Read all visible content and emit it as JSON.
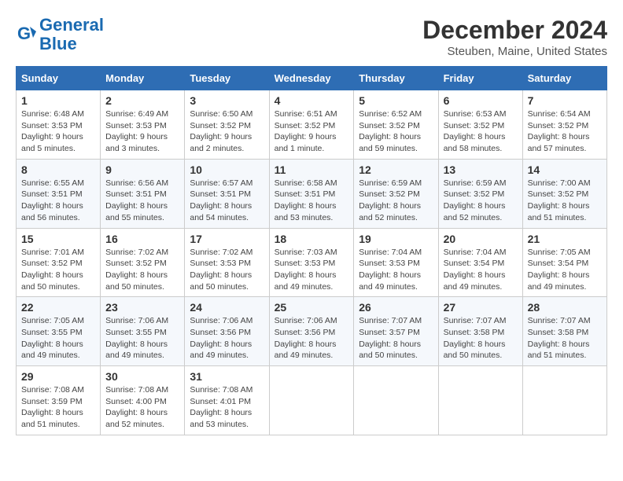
{
  "header": {
    "logo_line1": "General",
    "logo_line2": "Blue",
    "month_title": "December 2024",
    "location": "Steuben, Maine, United States"
  },
  "weekdays": [
    "Sunday",
    "Monday",
    "Tuesday",
    "Wednesday",
    "Thursday",
    "Friday",
    "Saturday"
  ],
  "weeks": [
    [
      {
        "day": "1",
        "info": "Sunrise: 6:48 AM\nSunset: 3:53 PM\nDaylight: 9 hours\nand 5 minutes."
      },
      {
        "day": "2",
        "info": "Sunrise: 6:49 AM\nSunset: 3:53 PM\nDaylight: 9 hours\nand 3 minutes."
      },
      {
        "day": "3",
        "info": "Sunrise: 6:50 AM\nSunset: 3:52 PM\nDaylight: 9 hours\nand 2 minutes."
      },
      {
        "day": "4",
        "info": "Sunrise: 6:51 AM\nSunset: 3:52 PM\nDaylight: 9 hours\nand 1 minute."
      },
      {
        "day": "5",
        "info": "Sunrise: 6:52 AM\nSunset: 3:52 PM\nDaylight: 8 hours\nand 59 minutes."
      },
      {
        "day": "6",
        "info": "Sunrise: 6:53 AM\nSunset: 3:52 PM\nDaylight: 8 hours\nand 58 minutes."
      },
      {
        "day": "7",
        "info": "Sunrise: 6:54 AM\nSunset: 3:52 PM\nDaylight: 8 hours\nand 57 minutes."
      }
    ],
    [
      {
        "day": "8",
        "info": "Sunrise: 6:55 AM\nSunset: 3:51 PM\nDaylight: 8 hours\nand 56 minutes."
      },
      {
        "day": "9",
        "info": "Sunrise: 6:56 AM\nSunset: 3:51 PM\nDaylight: 8 hours\nand 55 minutes."
      },
      {
        "day": "10",
        "info": "Sunrise: 6:57 AM\nSunset: 3:51 PM\nDaylight: 8 hours\nand 54 minutes."
      },
      {
        "day": "11",
        "info": "Sunrise: 6:58 AM\nSunset: 3:51 PM\nDaylight: 8 hours\nand 53 minutes."
      },
      {
        "day": "12",
        "info": "Sunrise: 6:59 AM\nSunset: 3:52 PM\nDaylight: 8 hours\nand 52 minutes."
      },
      {
        "day": "13",
        "info": "Sunrise: 6:59 AM\nSunset: 3:52 PM\nDaylight: 8 hours\nand 52 minutes."
      },
      {
        "day": "14",
        "info": "Sunrise: 7:00 AM\nSunset: 3:52 PM\nDaylight: 8 hours\nand 51 minutes."
      }
    ],
    [
      {
        "day": "15",
        "info": "Sunrise: 7:01 AM\nSunset: 3:52 PM\nDaylight: 8 hours\nand 50 minutes."
      },
      {
        "day": "16",
        "info": "Sunrise: 7:02 AM\nSunset: 3:52 PM\nDaylight: 8 hours\nand 50 minutes."
      },
      {
        "day": "17",
        "info": "Sunrise: 7:02 AM\nSunset: 3:53 PM\nDaylight: 8 hours\nand 50 minutes."
      },
      {
        "day": "18",
        "info": "Sunrise: 7:03 AM\nSunset: 3:53 PM\nDaylight: 8 hours\nand 49 minutes."
      },
      {
        "day": "19",
        "info": "Sunrise: 7:04 AM\nSunset: 3:53 PM\nDaylight: 8 hours\nand 49 minutes."
      },
      {
        "day": "20",
        "info": "Sunrise: 7:04 AM\nSunset: 3:54 PM\nDaylight: 8 hours\nand 49 minutes."
      },
      {
        "day": "21",
        "info": "Sunrise: 7:05 AM\nSunset: 3:54 PM\nDaylight: 8 hours\nand 49 minutes."
      }
    ],
    [
      {
        "day": "22",
        "info": "Sunrise: 7:05 AM\nSunset: 3:55 PM\nDaylight: 8 hours\nand 49 minutes."
      },
      {
        "day": "23",
        "info": "Sunrise: 7:06 AM\nSunset: 3:55 PM\nDaylight: 8 hours\nand 49 minutes."
      },
      {
        "day": "24",
        "info": "Sunrise: 7:06 AM\nSunset: 3:56 PM\nDaylight: 8 hours\nand 49 minutes."
      },
      {
        "day": "25",
        "info": "Sunrise: 7:06 AM\nSunset: 3:56 PM\nDaylight: 8 hours\nand 49 minutes."
      },
      {
        "day": "26",
        "info": "Sunrise: 7:07 AM\nSunset: 3:57 PM\nDaylight: 8 hours\nand 50 minutes."
      },
      {
        "day": "27",
        "info": "Sunrise: 7:07 AM\nSunset: 3:58 PM\nDaylight: 8 hours\nand 50 minutes."
      },
      {
        "day": "28",
        "info": "Sunrise: 7:07 AM\nSunset: 3:58 PM\nDaylight: 8 hours\nand 51 minutes."
      }
    ],
    [
      {
        "day": "29",
        "info": "Sunrise: 7:08 AM\nSunset: 3:59 PM\nDaylight: 8 hours\nand 51 minutes."
      },
      {
        "day": "30",
        "info": "Sunrise: 7:08 AM\nSunset: 4:00 PM\nDaylight: 8 hours\nand 52 minutes."
      },
      {
        "day": "31",
        "info": "Sunrise: 7:08 AM\nSunset: 4:01 PM\nDaylight: 8 hours\nand 53 minutes."
      },
      null,
      null,
      null,
      null
    ]
  ]
}
